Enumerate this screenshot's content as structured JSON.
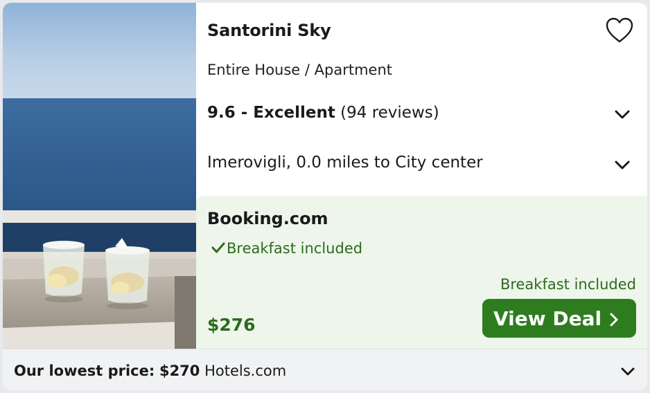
{
  "listing": {
    "name": "Santorini Sky",
    "type": "Entire House / Apartment",
    "rating_score": "9.6 - Excellent",
    "rating_reviews": "(94 reviews)",
    "location": "Imerovigli, 0.0 miles to City center"
  },
  "deal": {
    "provider": "Booking.com",
    "perk": "Breakfast included",
    "perk_secondary": "Breakfast included",
    "price": "$276",
    "button_label": "View Deal"
  },
  "footer": {
    "lowest_label": "Our lowest price:",
    "lowest_price": "$270",
    "lowest_provider": "Hotels.com"
  },
  "colors": {
    "accent_green": "#2d7d1f",
    "deal_bg": "#eef5ea",
    "perk_text": "#2d6a1f"
  },
  "icons": [
    "heart-icon",
    "chevron-down-icon",
    "check-icon",
    "chevron-right-icon"
  ]
}
